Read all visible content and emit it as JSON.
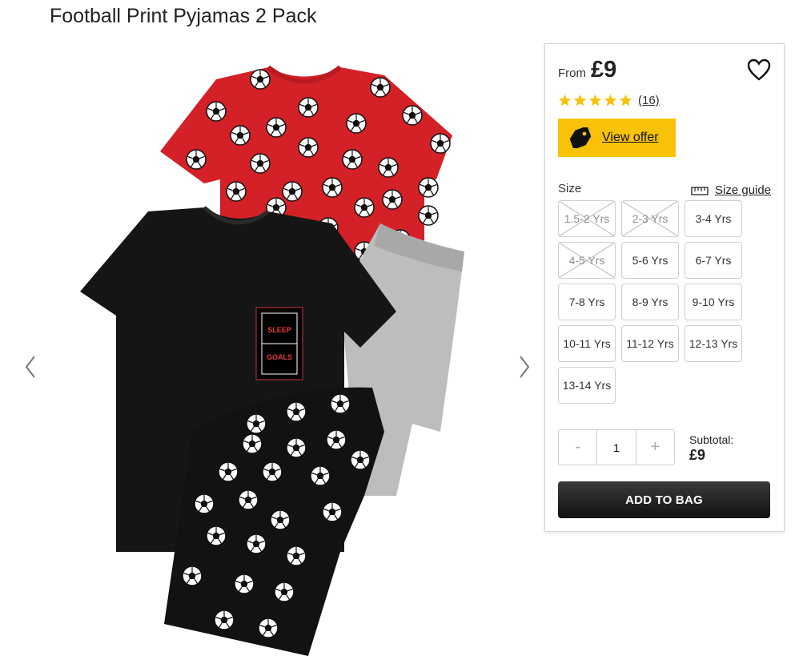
{
  "product": {
    "title": "Football Print Pyjamas 2 Pack"
  },
  "gallery": {
    "prev_icon": "chevron-left-icon",
    "next_icon": "chevron-right-icon",
    "print_text_top": "SLEEP",
    "print_text_bottom": "GOALS"
  },
  "price": {
    "from_label": "From",
    "amount": "£9"
  },
  "rating": {
    "stars": 5,
    "count": "(16)"
  },
  "offer": {
    "label": "View offer",
    "color": "#f7c209"
  },
  "size": {
    "label": "Size",
    "guide_label": "Size guide",
    "options": [
      {
        "label": "1.5-2 Yrs",
        "available": false
      },
      {
        "label": "2-3 Yrs",
        "available": false
      },
      {
        "label": "3-4 Yrs",
        "available": true
      },
      {
        "label": "4-5 Yrs",
        "available": false
      },
      {
        "label": "5-6 Yrs",
        "available": true
      },
      {
        "label": "6-7 Yrs",
        "available": true
      },
      {
        "label": "7-8 Yrs",
        "available": true
      },
      {
        "label": "8-9 Yrs",
        "available": true
      },
      {
        "label": "9-10 Yrs",
        "available": true
      },
      {
        "label": "10-11 Yrs",
        "available": true
      },
      {
        "label": "11-12 Yrs",
        "available": true
      },
      {
        "label": "12-13 Yrs",
        "available": true
      },
      {
        "label": "13-14 Yrs",
        "available": true
      }
    ]
  },
  "quantity": {
    "minus": "-",
    "value": "1",
    "plus": "+"
  },
  "subtotal": {
    "label": "Subtotal:",
    "value": "£9"
  },
  "cart": {
    "add_label": "ADD TO BAG"
  }
}
